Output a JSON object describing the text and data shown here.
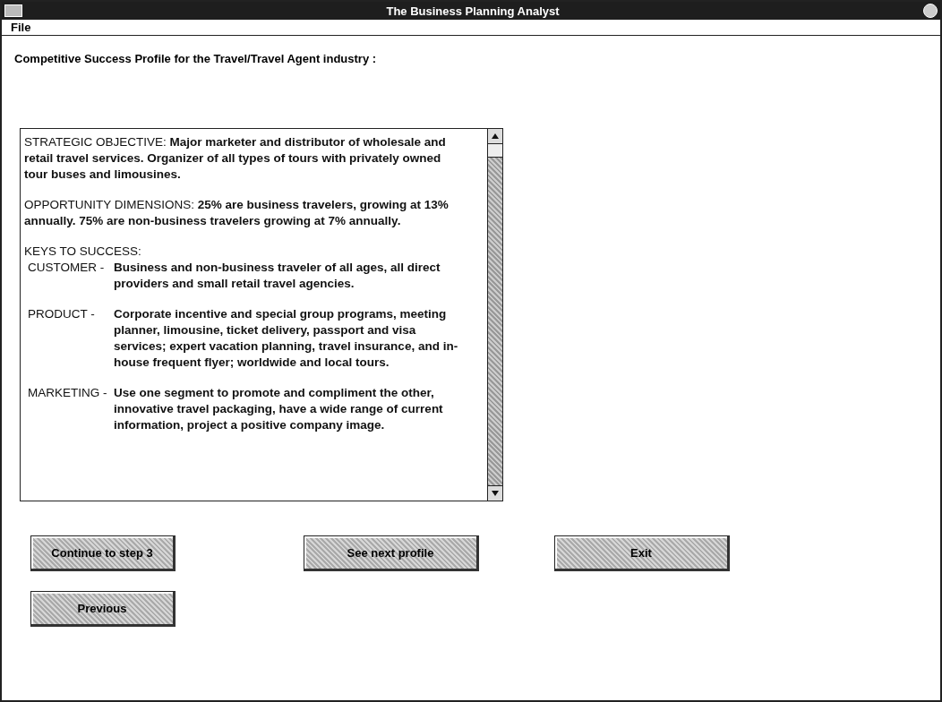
{
  "window": {
    "title": "The Business Planning Analyst"
  },
  "menu": [
    {
      "label": "File"
    }
  ],
  "heading": "Competitive Success Profile for the Travel/Travel Agent industry :",
  "profile": [
    {
      "kind": "paragraph",
      "text": "STRATEGIC OBJECTIVE: **Major marketer and distributor of wholesale and retail travel services.  Organizer of all types of tours with privately owned tour buses and limousines.**"
    },
    {
      "kind": "paragraph",
      "text": "OPPORTUNITY DIMENSIONS: **25% are business travelers, growing at 13% annually.  75% are non-business travelers growing at 7% annually.**"
    },
    {
      "kind": "heading",
      "text": "KEYS TO SUCCESS:"
    },
    {
      "kind": "entry",
      "label": "CUSTOMER -",
      "text": "Business and non-business traveler of all ages, all direct providers and small retail travel agencies."
    },
    {
      "kind": "entry",
      "label": "PRODUCT -",
      "text": "Corporate incentive and special group programs, meeting planner, limousine, ticket delivery, passport and visa services; expert vacation planning, travel insurance, and in-house frequent flyer; worldwide and local tours."
    },
    {
      "kind": "entry",
      "label": "MARKETING -",
      "text": "Use one segment to promote and compliment the other, innovative travel packaging, have a wide range of current information, project a positive company image."
    }
  ],
  "buttons": [
    {
      "label": "Continue to step 3"
    },
    {
      "label": "See next profile"
    },
    {
      "label": "Exit"
    },
    {
      "label": "Previous"
    }
  ]
}
